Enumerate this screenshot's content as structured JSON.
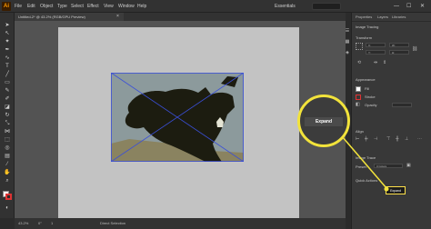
{
  "app": {
    "logo": "Ai"
  },
  "menu": [
    "File",
    "Edit",
    "Object",
    "Type",
    "Select",
    "Effect",
    "View",
    "Window",
    "Help"
  ],
  "workspace": {
    "label": "Essentials"
  },
  "window_controls": {
    "minimize": "—",
    "maximize": "☐",
    "close": "✕"
  },
  "document_tab": {
    "title": "Untitled-2* @ 43.2% (RGB/GPU Preview)",
    "close": "×"
  },
  "panel": {
    "tabs": [
      "Properties",
      "Layers",
      "Libraries"
    ],
    "group_label": "Image Tracing",
    "transform": {
      "title": "Transform",
      "x": "X:",
      "y": "Y:",
      "w": "W:",
      "h": "H:"
    },
    "appearance": {
      "title": "Appearance",
      "fill": "Fill",
      "stroke": "Stroke",
      "opacity": "Opacity"
    },
    "align": {
      "title": "Align"
    },
    "image_trace": {
      "title": "Image Trace",
      "preset": "Preset: ",
      "preset_value": "3 Colors"
    },
    "quick_actions": {
      "title": "Quick Actions"
    }
  },
  "buttons": {
    "expand": "Expand"
  },
  "status": {
    "zoom": "43.2%",
    "angle": "0°",
    "artboard": "1",
    "tool": "Direct Selection"
  },
  "colors": {
    "accent": "#f2e33b",
    "chrome": "#323232",
    "canvas": "#535353",
    "artboard": "#c3c3c3"
  }
}
